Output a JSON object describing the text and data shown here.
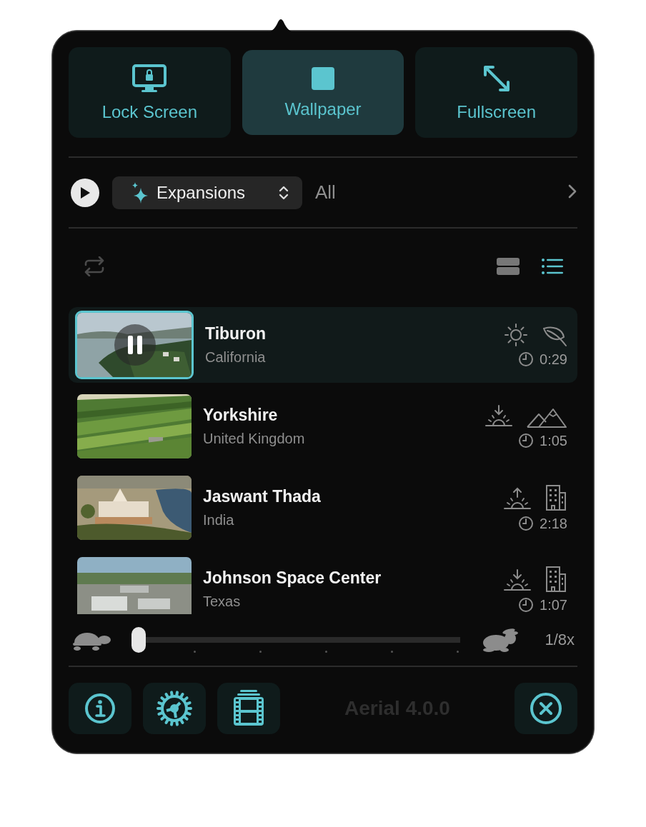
{
  "modes": [
    {
      "label": "Lock Screen",
      "kind": "lock",
      "selected": false
    },
    {
      "label": "Wallpaper",
      "kind": "wallpaper",
      "selected": true
    },
    {
      "label": "Fullscreen",
      "kind": "fullscreen",
      "selected": false
    }
  ],
  "source": {
    "dropdown": "Expansions",
    "filter": "All"
  },
  "view": {
    "repeat": false,
    "options": [
      {
        "kind": "cards",
        "selected": false
      },
      {
        "kind": "list",
        "selected": true
      }
    ]
  },
  "videos": [
    {
      "title": "Tiburon",
      "subtitle": "California",
      "duration": "0:29",
      "icons": [
        {
          "kind": "day"
        },
        {
          "kind": "nature"
        }
      ],
      "selected": true
    },
    {
      "title": "Yorkshire",
      "subtitle": "United Kingdom",
      "duration": "1:05",
      "icons": [
        {
          "kind": "sunset"
        },
        {
          "kind": "mountains"
        }
      ],
      "selected": false
    },
    {
      "title": "Jaswant Thada",
      "subtitle": "India",
      "duration": "2:18",
      "icons": [
        {
          "kind": "sunrise"
        },
        {
          "kind": "city"
        }
      ],
      "selected": false
    },
    {
      "title": "Johnson Space Center",
      "subtitle": "Texas",
      "duration": "1:07",
      "icons": [
        {
          "kind": "sunset"
        },
        {
          "kind": "city"
        }
      ],
      "selected": false
    }
  ],
  "speed": {
    "level": 0,
    "reading": "1/8x"
  },
  "footer": {
    "version": "Aerial 4.0.0"
  }
}
